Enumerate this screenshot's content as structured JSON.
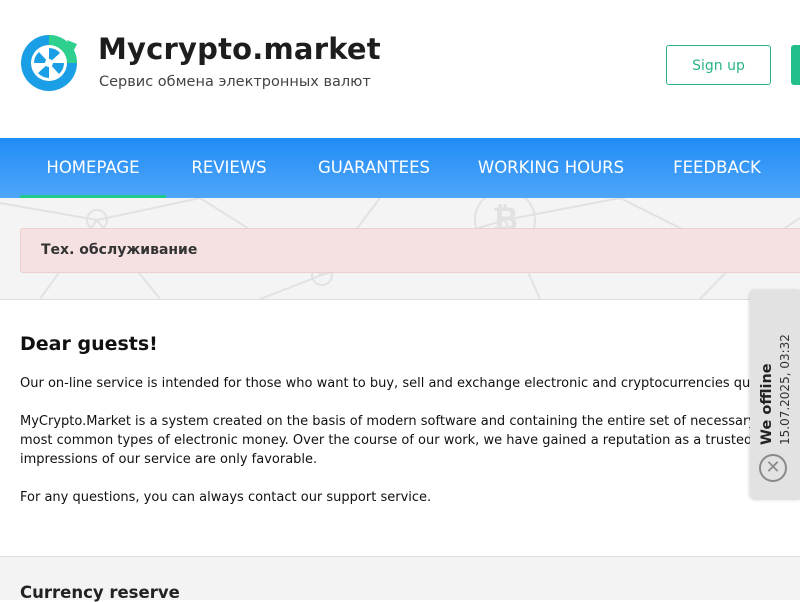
{
  "header": {
    "brand_title": "Mycrypto.market",
    "brand_subtitle": "Сервис обмена электронных валют",
    "signup_label": "Sign up"
  },
  "nav": {
    "items": [
      {
        "label": "HOMEPAGE"
      },
      {
        "label": "REVIEWS"
      },
      {
        "label": "GUARANTEES"
      },
      {
        "label": "WORKING HOURS"
      },
      {
        "label": "FEEDBACK"
      }
    ],
    "active": "HOMEPAGE"
  },
  "alert": {
    "text": "Тех. обслуживание"
  },
  "welcome": {
    "title": "Dear guests!",
    "paragraph1": "Our on-line service is intended for those who want to buy, sell and exchange electronic and cryptocurrencies quickly, safely an",
    "paragraph2_line1": "MyCrypto.Market is a system created on the basis of modern software and containing the entire set of necessary functions for c",
    "paragraph2_line2": "most common types of electronic money. Over the course of our work, we have gained a reputation as a trusted partner and do",
    "paragraph2_line3": "impressions of our service are only favorable.",
    "paragraph3": "For any questions, you can always contact our support service."
  },
  "reserve": {
    "title": "Currency reserve"
  },
  "chat": {
    "status": "We offline",
    "timestamp": "15.07.2025, 03:32",
    "close_icon": "close-icon"
  },
  "colors": {
    "accent_green": "#29b487",
    "nav_blue": "#1f8df5",
    "alert_bg": "#f5e1e1"
  }
}
